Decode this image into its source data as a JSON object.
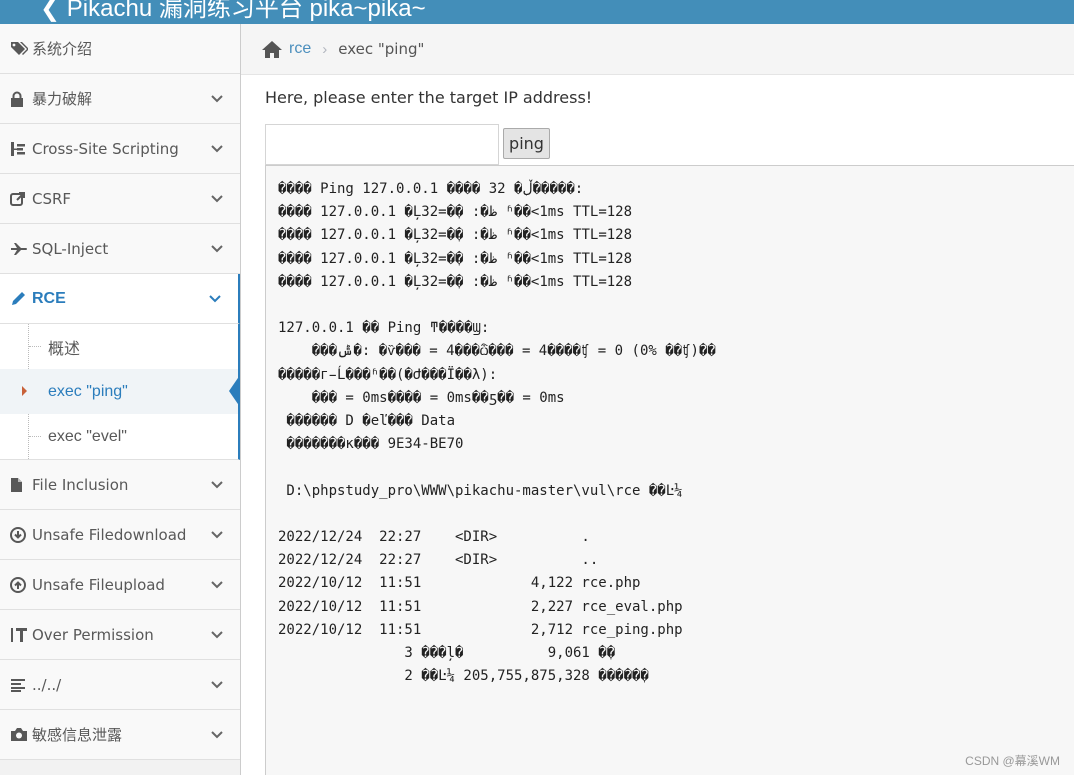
{
  "app": {
    "title": "Pikachu 漏洞练习平台 pika~pika~"
  },
  "sidebar": {
    "items": [
      {
        "label": "系统介绍",
        "icon": "tags-icon",
        "expandable": false
      },
      {
        "label": "暴力破解",
        "icon": "lock-icon",
        "expandable": true
      },
      {
        "label": "Cross-Site Scripting",
        "icon": "sitemap-icon",
        "expandable": true
      },
      {
        "label": "CSRF",
        "icon": "share-icon",
        "expandable": true
      },
      {
        "label": "SQL-Inject",
        "icon": "plane-icon",
        "expandable": true
      },
      {
        "label": "RCE",
        "icon": "pencil-icon",
        "expandable": true,
        "active": true
      },
      {
        "label": "File Inclusion",
        "icon": "file-icon",
        "expandable": true
      },
      {
        "label": "Unsafe Filedownload",
        "icon": "download-icon",
        "expandable": true
      },
      {
        "label": "Unsafe Fileupload",
        "icon": "upload-icon",
        "expandable": true
      },
      {
        "label": "Over Permission",
        "icon": "text-height-icon",
        "expandable": true
      },
      {
        "label": "../../",
        "icon": "align-left-icon",
        "expandable": true
      },
      {
        "label": "敏感信息泄露",
        "icon": "camera-icon",
        "expandable": true
      }
    ],
    "rce_submenu": [
      {
        "label": "概述"
      },
      {
        "label": "exec \"ping\"",
        "active": true
      },
      {
        "label": "exec \"evel\""
      }
    ]
  },
  "breadcrumb": {
    "home_label": "rce",
    "current": "exec \"ping\""
  },
  "form": {
    "prompt": "Here, please enter the target IP address!",
    "ip_value": "",
    "button_label": "ping"
  },
  "output": {
    "text": "���� Ping 127.0.0.1 ���� 32 �ֽڵ�����:\n���� 127.0.0.1 �Ļظ�: �ֽ�=32 ʱ��<1ms TTL=128\n���� 127.0.0.1 �Ļظ�: �ֽ�=32 ʱ��<1ms TTL=128\n���� 127.0.0.1 �Ļظ�: �ֽ�=32 ʱ��<1ms TTL=128\n���� 127.0.0.1 �Ļظ�: �ֽ�=32 ʱ��<1ms TTL=128\n\n127.0.0.1 �� Ping ͳ����Ϣ:\n    ���ݰ�: �ѷ��� = 4���ѽ��� = 4����ʧ = 0 (0% ��ʧ)��\n�����г̵Ĺ���ʱ��(�Ժ���Ϊ��λ):\n    ��� = 0ms���� = 0ms��ƽ�� = 0ms\n ������ D �еľ��� Data\n �������к��� 9E34-BE70\n\n D:\\phpstudy_pro\\WWW\\pikachu-master\\vul\\rce ��Ŀ¼\n\n2022/12/24  22:27    <DIR>          .\n2022/12/24  22:27    <DIR>          ..\n2022/10/12  11:51             4,122 rce.php\n2022/10/12  11:51             2,227 rce_eval.php\n2022/10/12  11:51             2,712 rce_ping.php\n               3 ���ļ�          9,061 �ֽ�\n               2 ��Ŀ¼ 205,755,875,328 �����ֽ�"
  },
  "watermark": "CSDN @幕溪WM"
}
